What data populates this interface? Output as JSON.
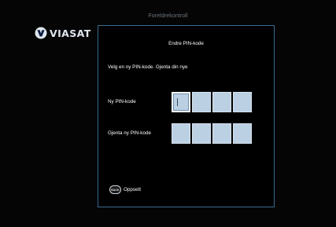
{
  "header": {
    "title": "Foreldrekontroll"
  },
  "logo": {
    "text": "VIASAT",
    "icon": "viasat-logo-icon"
  },
  "dialog": {
    "title": "Endre PIN-kode",
    "instruction": "Velg en ny PIN-kode. Gjenta din nye",
    "new_pin": {
      "label": "Ny PIN-kode",
      "digits": [
        "",
        "",
        "",
        ""
      ],
      "active_index": 0
    },
    "repeat_pin": {
      "label": "Gjenta ny PIN-kode",
      "digits": [
        "",
        "",
        "",
        ""
      ]
    },
    "back": {
      "icon_text": "BACK",
      "label": "Oppsett"
    }
  },
  "colors": {
    "background": "#000000",
    "panel_border": "#3a6b8f",
    "pin_box": "#bcd0e3",
    "header_text": "#6f7780"
  }
}
